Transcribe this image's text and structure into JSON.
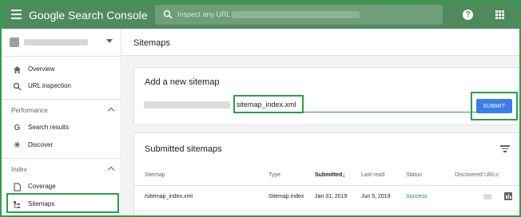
{
  "app": {
    "title": "Google Search Console",
    "search_placeholder": "Inspect any URL in"
  },
  "sidebar": {
    "items": [
      {
        "label": "Overview",
        "icon": "home-icon"
      },
      {
        "label": "URL inspection",
        "icon": "search-icon"
      }
    ],
    "sections": [
      {
        "label": "Performance",
        "items": [
          {
            "label": "Search results",
            "icon": "google-g-icon"
          },
          {
            "label": "Discover",
            "icon": "asterisk-icon"
          }
        ]
      },
      {
        "label": "Index",
        "items": [
          {
            "label": "Coverage",
            "icon": "document-icon"
          },
          {
            "label": "Sitemaps",
            "icon": "sitemap-icon"
          }
        ]
      }
    ]
  },
  "page": {
    "title": "Sitemaps"
  },
  "add_sitemap": {
    "title": "Add a new sitemap",
    "input_value": "sitemap_index.xml",
    "submit_label": "SUBMIT"
  },
  "submitted": {
    "title": "Submitted sitemaps",
    "columns": [
      "Sitemap",
      "Type",
      "Submitted",
      "Last read",
      "Status",
      "Discovered URLs"
    ],
    "rows": [
      {
        "sitemap": "/sitemap_index.xml",
        "type": "Sitemap index",
        "submitted": "Jan 31, 2019",
        "last_read": "Jun 5, 2019",
        "status": "Success"
      }
    ]
  },
  "colors": {
    "header": "#4f8a5c",
    "highlight": "#2e9e4a",
    "submit": "#3b7de9",
    "success": "#1e8e3e"
  }
}
